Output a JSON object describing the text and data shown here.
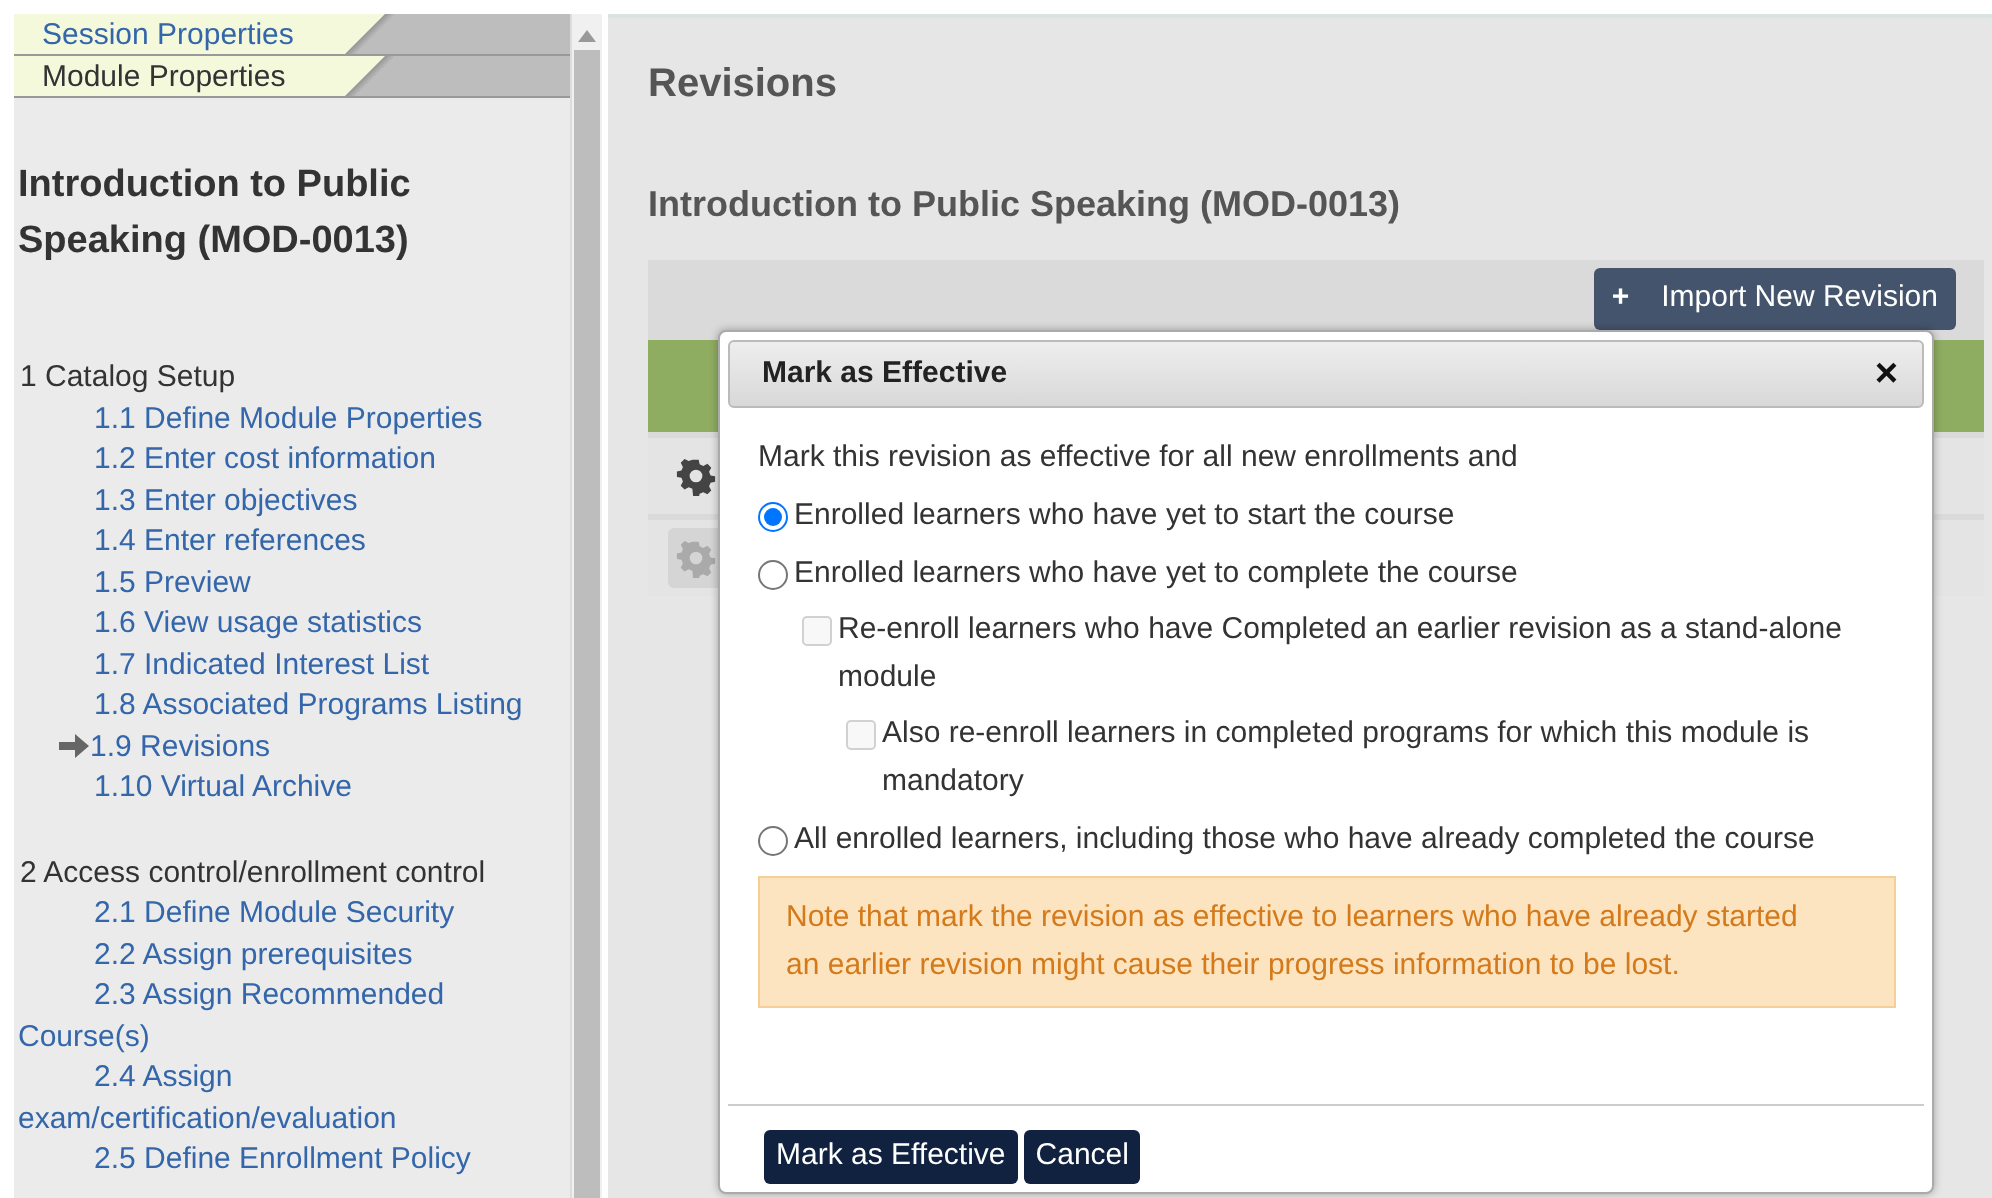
{
  "sidebar": {
    "tabs": [
      {
        "label": "Session Properties",
        "selected": false
      },
      {
        "label": "Module Properties",
        "selected": true
      }
    ],
    "title": "Introduction to Public Speaking (MOD-0013)",
    "sections": [
      {
        "label": "1 Catalog Setup",
        "children": [
          {
            "label": "1.1 Define Module Properties",
            "current": false
          },
          {
            "label": "1.2 Enter cost information",
            "current": false
          },
          {
            "label": "1.3 Enter objectives",
            "current": false
          },
          {
            "label": "1.4 Enter references",
            "current": false
          },
          {
            "label": "1.5 Preview",
            "current": false
          },
          {
            "label": "1.6 View usage statistics",
            "current": false
          },
          {
            "label": "1.7 Indicated Interest List",
            "current": false
          },
          {
            "label": "1.8 Associated Programs Listing",
            "current": false
          },
          {
            "label": "1.9 Revisions",
            "current": true
          },
          {
            "label": "1.10 Virtual Archive",
            "current": false
          }
        ]
      },
      {
        "label": "2 Access control/enrollment control",
        "children": [
          {
            "label": "2.1 Define Module Security",
            "current": false
          },
          {
            "label": "2.2 Assign prerequisites",
            "current": false
          },
          {
            "label": "2.3 Assign Recommended Course(s)",
            "current": false
          },
          {
            "label": "2.4 Assign exam/certification/evaluation",
            "current": false
          },
          {
            "label": "2.5 Define Enrollment Policy",
            "current": false
          }
        ]
      }
    ]
  },
  "main": {
    "heading": "Revisions",
    "subheading": "Introduction to Public Speaking (MOD-0013)",
    "import_button": {
      "icon": "+",
      "label": "Import New Revision"
    },
    "rows": [
      {
        "enabled": true
      },
      {
        "enabled": false
      }
    ]
  },
  "dialog": {
    "title": "Mark as Effective",
    "close": "×",
    "intro": "Mark this revision as effective for all new enrollments and",
    "options": [
      {
        "kind": "radio",
        "label": "Enrolled learners who have yet to start the course",
        "selected": true
      },
      {
        "kind": "radio",
        "label": "Enrolled learners who have yet to complete the course",
        "selected": false,
        "children": [
          {
            "kind": "checkbox",
            "label": "Re-enroll learners who have Completed an earlier revision as a stand-alone module",
            "checked": false,
            "disabled": true,
            "children": [
              {
                "kind": "checkbox",
                "label": "Also re-enroll learners in completed programs for which this module is mandatory",
                "checked": false,
                "disabled": true
              }
            ]
          }
        ]
      },
      {
        "kind": "radio",
        "label": "All enrolled learners, including those who have already completed the course",
        "selected": false
      }
    ],
    "warning": "Note that mark the revision as effective to learners who have already started an earlier revision might cause their progress information to be lost.",
    "buttons": [
      "Mark as Effective",
      "Cancel"
    ]
  }
}
